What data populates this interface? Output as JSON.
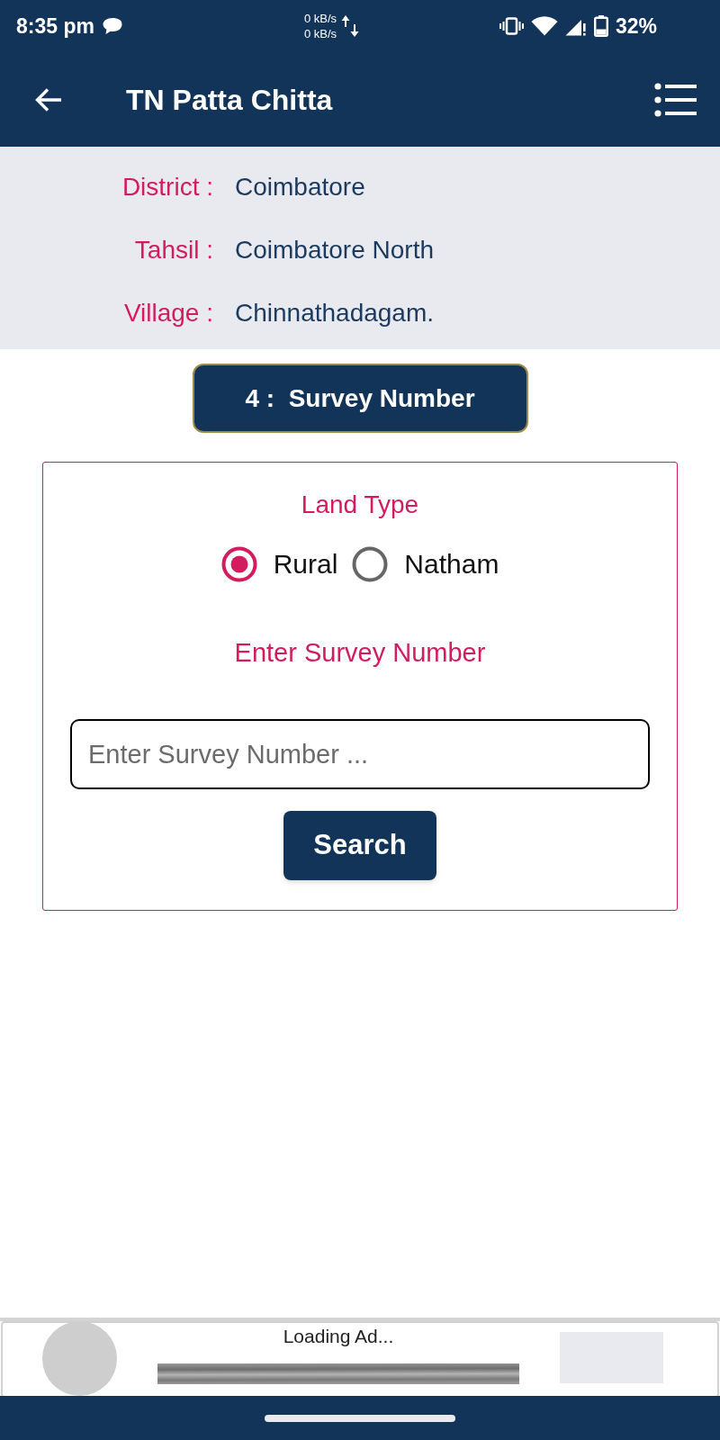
{
  "status_bar": {
    "time": "8:35 pm",
    "net_up": "0 kB/s",
    "net_down": "0 kB/s",
    "battery": "32%"
  },
  "app_bar": {
    "title": "TN Patta Chitta"
  },
  "location": [
    {
      "label": "District :",
      "value": "Coimbatore"
    },
    {
      "label": "Tahsil :",
      "value": "Coimbatore North"
    },
    {
      "label": "Village :",
      "value": "Chinnathadagam."
    }
  ],
  "step": {
    "title": "4 :  Survey Number"
  },
  "land_type": {
    "label": "Land Type",
    "options": [
      {
        "label": "Rural",
        "selected": true
      },
      {
        "label": "Natham",
        "selected": false
      }
    ]
  },
  "survey_input": {
    "label": "Enter Survey Number",
    "placeholder": "Enter Survey Number ..."
  },
  "search_button": {
    "label": "Search"
  },
  "ad": {
    "text": "Loading Ad..."
  }
}
